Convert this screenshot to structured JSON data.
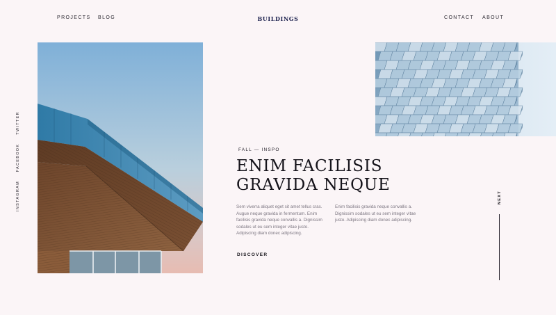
{
  "header": {
    "nav_left": [
      "PROJECTS",
      "BLOG"
    ],
    "brand": "BUILDINGS",
    "nav_right": [
      "CONTACT",
      "ABOUT"
    ]
  },
  "social": [
    "TWITTER",
    "FACEBOOK",
    "INSTAGRAM"
  ],
  "hero": {
    "eyebrow": "FALL — INSPO",
    "headline_line1": "ENIM FACILISIS",
    "headline_line2": "GRAVIDA NEQUE",
    "paragraph_left": "Sem viverra aliquet eget sit amet tellus cras. Augue neque gravida in fermentum. Enim facilisis gravida neque convallis a. Dignissim sodales ut eu sem integer vitae justo. Adipiscing diam donec adipiscing.",
    "paragraph_right": "Enim facilisis gravida neque convallis a. Dignissim sodales ut eu sem integer vitae justo. Adipiscing diam donec adipiscing.",
    "cta": "DISCOVER"
  },
  "next": {
    "label": "NEXT"
  },
  "colors": {
    "background": "#fbf5f7",
    "brand": "#1f2450",
    "text": "#15131a",
    "muted_text": "#7d7782"
  }
}
